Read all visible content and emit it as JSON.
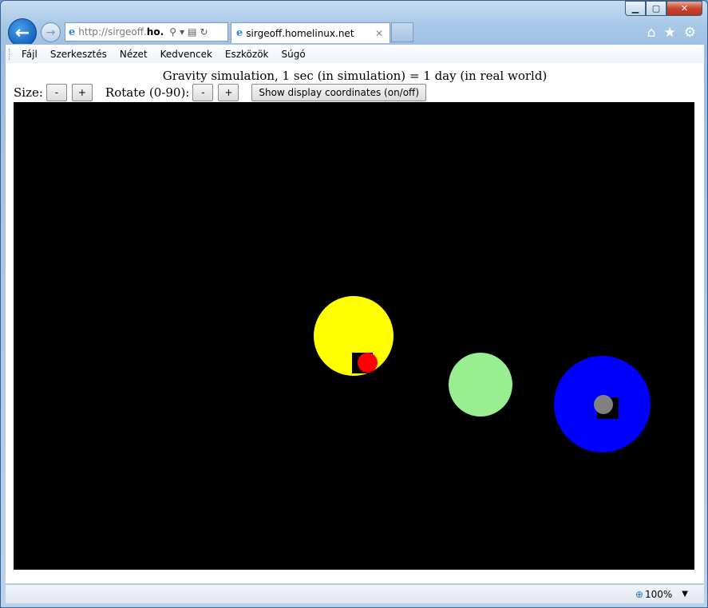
{
  "browser": {
    "address_prefix": "http://sirgeoff.",
    "address_bold": "ho...",
    "tab_title": "sirgeoff.homelinux.net",
    "menu": [
      "Fájl",
      "Szerkesztés",
      "Nézet",
      "Kedvencek",
      "Eszközök",
      "Súgó"
    ],
    "zoom": "100%"
  },
  "page": {
    "heading": "Gravity simulation, 1 sec (in simulation) = 1 day (in real world)",
    "size_label": "Size:",
    "rotate_label": "Rotate (0-90):",
    "minus": "-",
    "plus": "+",
    "coords_button": "Show display coordinates (on/off)"
  },
  "simulation": {
    "background": "#000000",
    "bodies": [
      {
        "name": "yellow-body",
        "color": "#ffff00"
      },
      {
        "name": "red-body",
        "color": "#ff0000"
      },
      {
        "name": "green-body",
        "color": "#98ee90"
      },
      {
        "name": "blue-body",
        "color": "#0000ff"
      },
      {
        "name": "gray-body",
        "color": "#808080"
      }
    ]
  }
}
